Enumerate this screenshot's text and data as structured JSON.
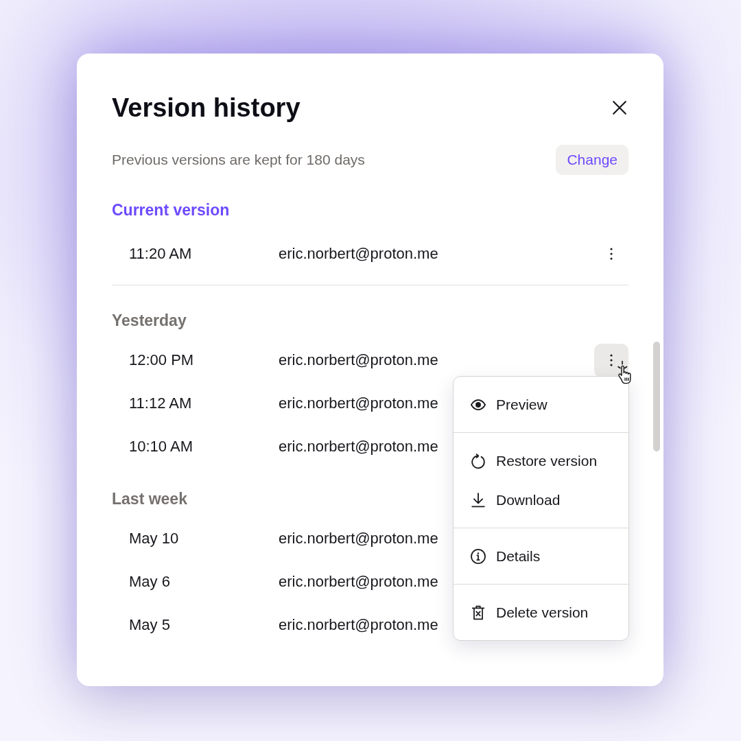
{
  "dialog": {
    "title": "Version history",
    "retention_note": "Previous versions are kept for 180 days",
    "change_button": "Change"
  },
  "sections": [
    {
      "kind": "current",
      "heading": "Current version",
      "versions": [
        {
          "time": "11:20 AM",
          "author": "eric.norbert@proton.me",
          "menu_open": false
        }
      ]
    },
    {
      "kind": "history",
      "heading": "Yesterday",
      "versions": [
        {
          "time": "12:00 PM",
          "author": "eric.norbert@proton.me",
          "menu_open": true
        },
        {
          "time": "11:12 AM",
          "author": "eric.norbert@proton.me"
        },
        {
          "time": "10:10 AM",
          "author": "eric.norbert@proton.me"
        }
      ]
    },
    {
      "kind": "history",
      "heading": "Last week",
      "versions": [
        {
          "time": "May 10",
          "author": "eric.norbert@proton.me"
        },
        {
          "time": "May 6",
          "author": "eric.norbert@proton.me"
        },
        {
          "time": "May 5",
          "author": "eric.norbert@proton.me"
        }
      ]
    }
  ],
  "context_menu": {
    "groups": [
      {
        "items": [
          {
            "kind": "preview",
            "label": "Preview"
          }
        ]
      },
      {
        "items": [
          {
            "kind": "restore",
            "label": "Restore version"
          },
          {
            "kind": "download",
            "label": "Download"
          }
        ]
      },
      {
        "items": [
          {
            "kind": "details",
            "label": "Details"
          }
        ]
      },
      {
        "items": [
          {
            "kind": "delete",
            "label": "Delete version"
          }
        ]
      }
    ]
  }
}
